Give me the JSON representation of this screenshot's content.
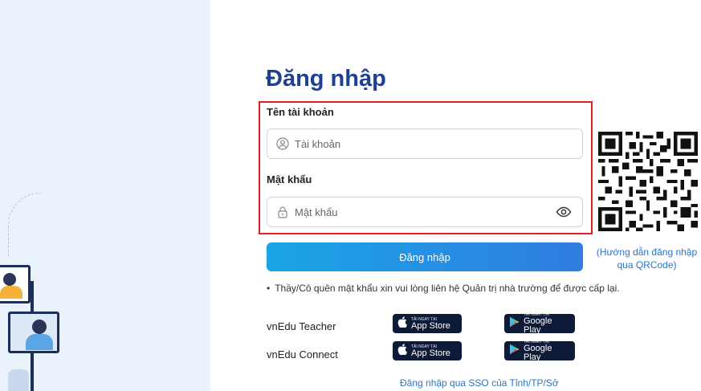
{
  "title": "Đăng nhập",
  "username": {
    "label": "Tên tài khoản",
    "placeholder": "Tài khoản",
    "icon": "user-circle-icon"
  },
  "password": {
    "label": "Mật khẩu",
    "placeholder": "Mật khẩu",
    "icon": "lock-icon",
    "toggle_icon": "eye-icon"
  },
  "login_button": "Đăng nhập",
  "qr_help": "(Hướng dẫn đăng nhập qua QRCode)",
  "note": "Thầy/Cô quên mật khẩu xin vui lòng liên hệ Quản trị nhà trường để được cấp lại.",
  "apps": [
    {
      "name": "vnEdu Teacher",
      "appstore_top": "TẢI NGAY TẠI",
      "appstore": "App Store",
      "gplay_top": "TẢI NGAY TẠI",
      "gplay": "Google Play"
    },
    {
      "name": "vnEdu Connect",
      "appstore_top": "TẢI NGAY TẠI",
      "appstore": "App Store",
      "gplay_top": "TẢI NGAY TẠI",
      "gplay": "Google Play"
    }
  ],
  "sso_link": "Đăng nhập qua SSO của Tỉnh/TP/Sở",
  "colors": {
    "title": "#1f3f8f",
    "highlight": "#e11f26",
    "button_start": "#1aa5e6",
    "button_end": "#2f7de0",
    "link": "#2a76c7"
  }
}
